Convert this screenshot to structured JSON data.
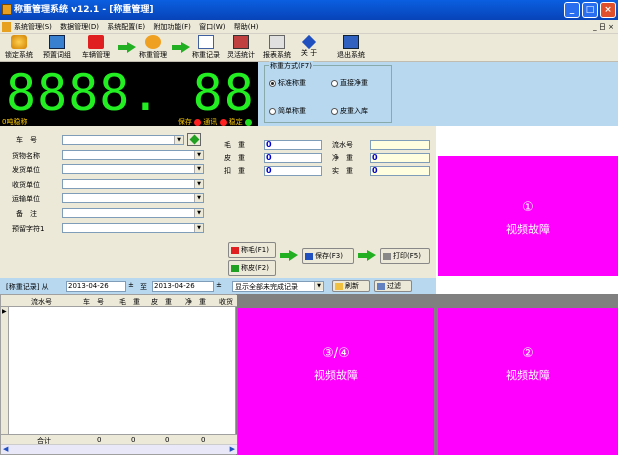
{
  "window": {
    "title": "称重管理系统 v12.1 - [称重管理]",
    "min": "_",
    "max": "□",
    "close": "×"
  },
  "menu": {
    "items": [
      "系统管理(S)",
      "数据管理(D)",
      "系统配置(E)",
      "附加功能(F)",
      "窗口(W)",
      "帮助(H)"
    ],
    "right": "_ 日 ×"
  },
  "toolbar": {
    "lock": "锁定系统",
    "preset": "预置词组",
    "vehicle": "车辆管理",
    "weigh": "称重管理",
    "records": "称重记录",
    "report": "灵活统计",
    "reportsys": "报表系统",
    "about": "关 于",
    "exit": "退出系统"
  },
  "lcd": {
    "value": "8888. 88",
    "left_status": "0吨稳称",
    "save": "保存",
    "comm": "通讯",
    "stable": "稳定",
    "colors": {
      "save": "#ff2020",
      "comm": "#ff2020",
      "stable": "#20e020"
    }
  },
  "weighmode": {
    "legend": "称重方式(F7)",
    "opt1": "标准称重",
    "opt2": "直接净重",
    "opt3": "简单称重",
    "opt4": "皮重入库"
  },
  "form": {
    "labels": [
      "车　号",
      "货物名称",
      "发货单位",
      "收货单位",
      "运输单位",
      "备　注",
      "预留字符1"
    ],
    "gross_label": "毛　重",
    "tare_label": "皮　重",
    "deduct_label": "扣　重",
    "gross": "0",
    "tare": "0",
    "deduct": "0",
    "serial_label": "流水号",
    "net_label": "净　重",
    "actual_label": "实　重",
    "serial": "",
    "net": "0",
    "actual": "0"
  },
  "buttons": {
    "gross": "称毛(F1)",
    "tare": "称皮(F2)",
    "save": "保存(F3)",
    "print": "打印(F5)"
  },
  "video": {
    "v1": {
      "num": "①",
      "text": "视频故障"
    },
    "v2": {
      "num": "②",
      "text": "视频故障"
    },
    "v34": {
      "num": "③/④",
      "text": "视频故障"
    }
  },
  "records": {
    "label": "[称重记录] 从",
    "from": "2013-04-26",
    "to_label": "至",
    "to": "2013-04-26",
    "filter": "显示全部未完成记录",
    "refresh": "刷新",
    "filterbtn": "过滤"
  },
  "grid": {
    "headers": [
      "流水号",
      "车　号",
      "毛　重",
      "皮　重",
      "净　重",
      "收货"
    ],
    "footer_label": "合计",
    "footer": [
      "0",
      "0",
      "0",
      "0"
    ]
  },
  "accent": {
    "titlebar": "#0a5fe0",
    "video": "#ff00ff",
    "panel": "#b8d8f0"
  }
}
